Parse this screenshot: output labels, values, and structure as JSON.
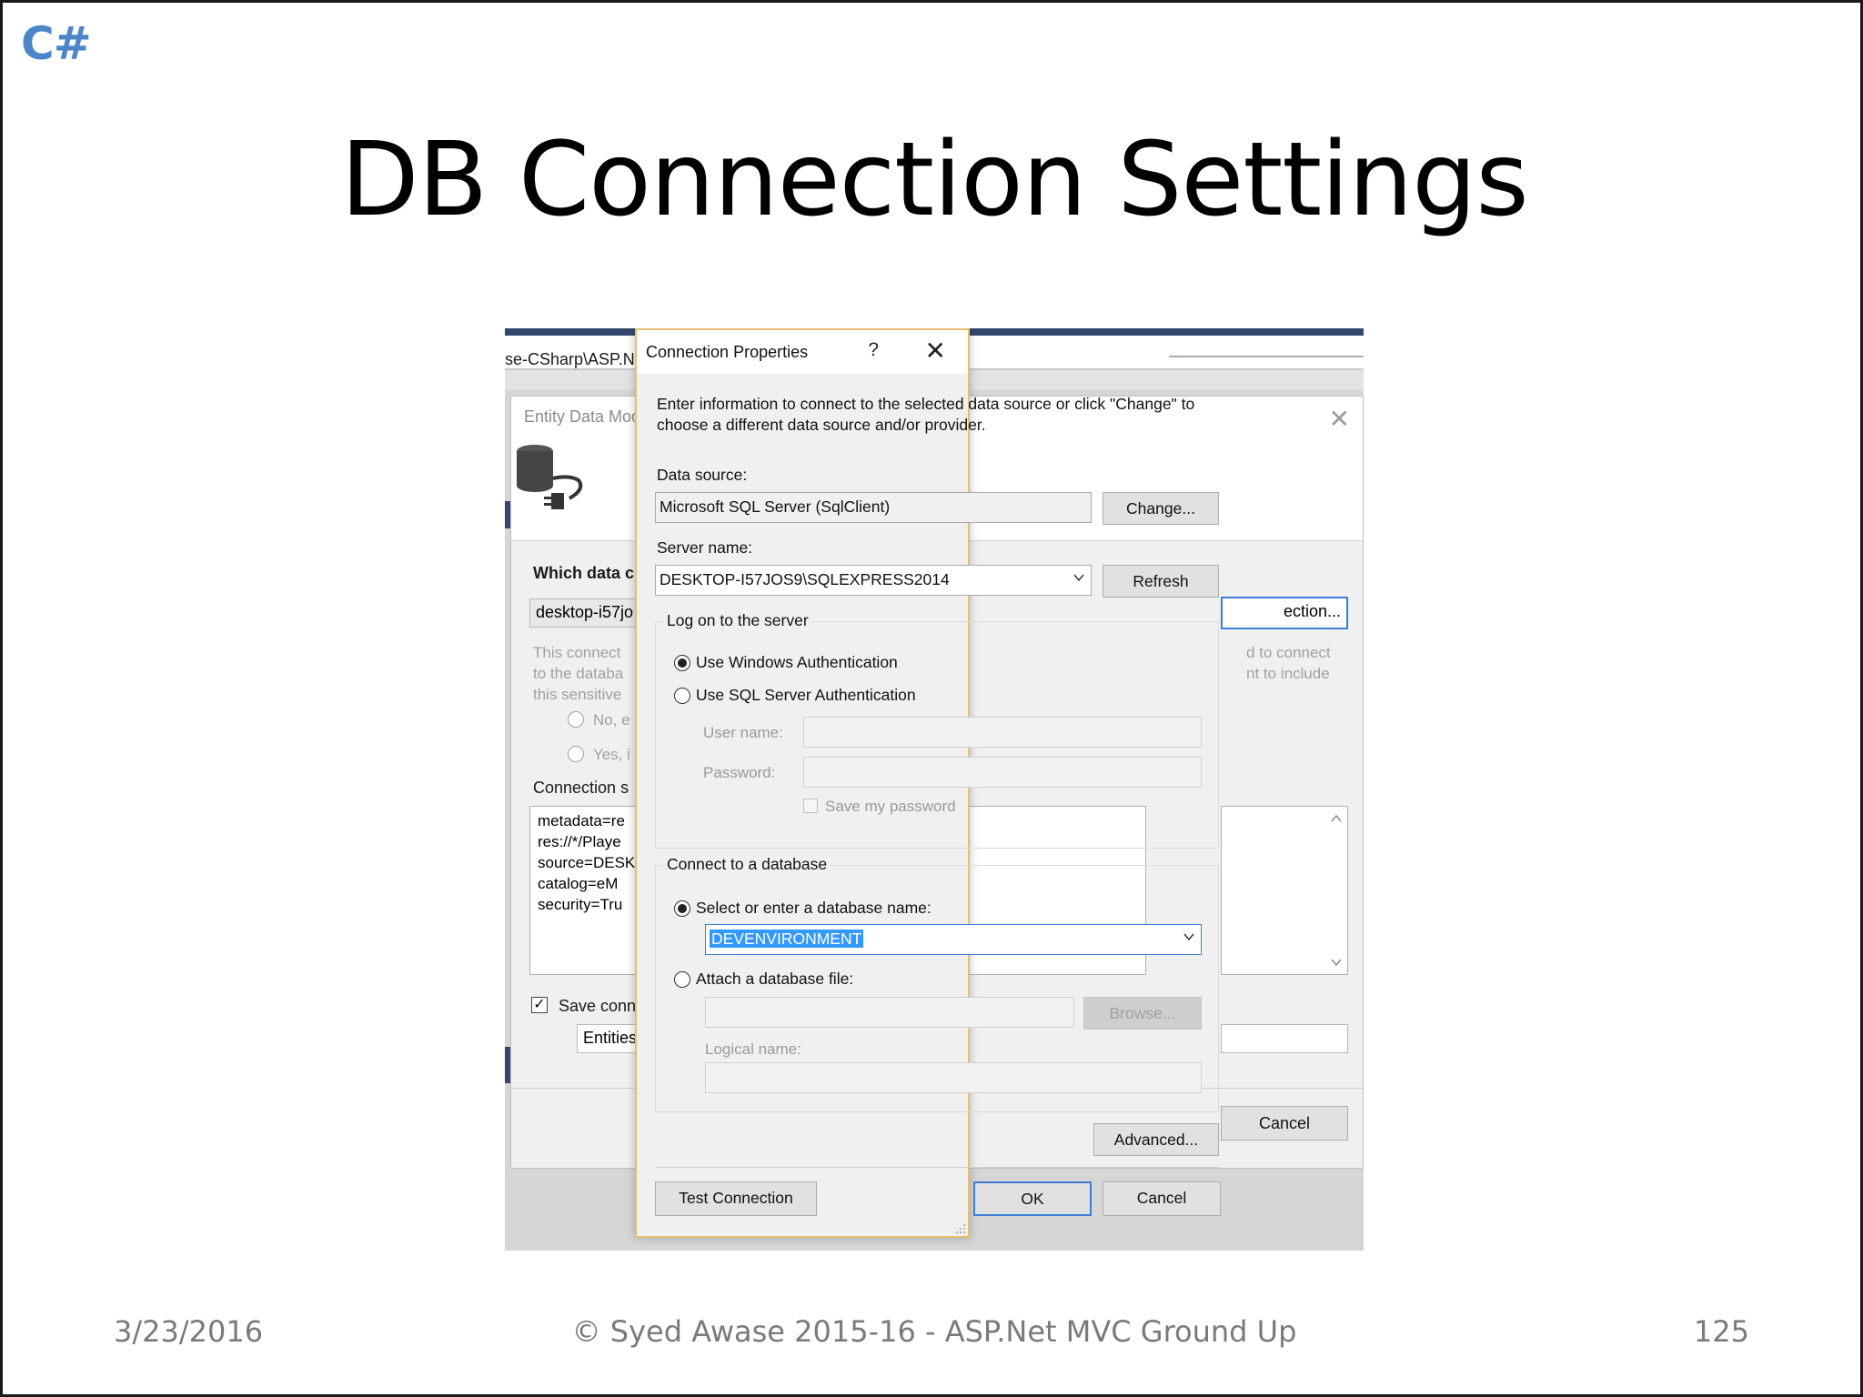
{
  "slide": {
    "logo": "C#",
    "title": "DB Connection Settings",
    "footer_date": "3/23/2016",
    "footer_center": "© Syed Awase 2015-16 - ASP.Net MVC Ground Up",
    "footer_page": "125"
  },
  "background_window": {
    "path_text": "se-CSharp\\ASP.NE",
    "wizard_title": "Entity Data Mod",
    "which_data_label": "Which data c",
    "connection_field": "desktop-i57jo",
    "new_connection_button": "ection...",
    "gray_text_left": [
      "This connect",
      "to the databa",
      "this sensitive"
    ],
    "gray_text_right": [
      "d to connect",
      "nt to include"
    ],
    "radio_no": "No, e",
    "radio_yes": "Yes, i",
    "connection_string_label": "Connection s",
    "connection_string_lines": "metadata=re\nres://*/Playe\nsource=DESK\ncatalog=eM\nsecurity=Tru",
    "save_conn_label": "Save conn",
    "entities_field": "Entities",
    "cancel_button": "Cancel"
  },
  "dialog": {
    "title": "Connection Properties",
    "help": "?",
    "intro_line1": "Enter information to connect to the selected data source or click \"Change\" to",
    "intro_line2": "choose a different data source and/or provider.",
    "data_source_label": "Data source:",
    "data_source_value": "Microsoft SQL Server (SqlClient)",
    "change_button": "Change...",
    "server_name_label": "Server name:",
    "server_name_value": "DESKTOP-I57JOS9\\SQLEXPRESS2014",
    "refresh_button": "Refresh",
    "logon_group": "Log on to the server",
    "windows_auth": "Use Windows Authentication",
    "sql_auth": "Use SQL Server Authentication",
    "user_name_label": "User name:",
    "password_label": "Password:",
    "save_password": "Save my password",
    "connect_db_group": "Connect to a database",
    "select_db_option": "Select or enter a database name:",
    "db_name_value": "DEVENVIRONMENT",
    "attach_db_option": "Attach a database file:",
    "browse_button": "Browse...",
    "logical_name_label": "Logical name:",
    "advanced_button": "Advanced...",
    "test_connection_button": "Test Connection",
    "ok_button": "OK",
    "cancel_button": "Cancel"
  }
}
